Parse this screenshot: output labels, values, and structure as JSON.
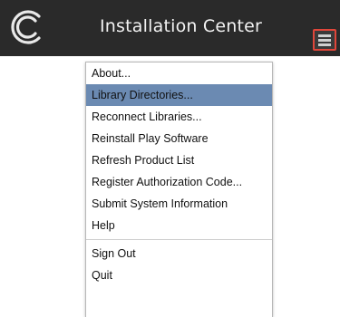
{
  "window": {
    "title": "Installation Center"
  },
  "icons": {
    "logo": "app-logo-icon",
    "menu": "hamburger-menu-icon"
  },
  "colors": {
    "titlebar": "#2a2a2a",
    "selected": "#6b8ab2",
    "menu_button_border": "#e0463a"
  },
  "menu": {
    "group1": [
      {
        "label": "About..."
      },
      {
        "label": "Library Directories...",
        "selected": true
      },
      {
        "label": "Reconnect Libraries..."
      },
      {
        "label": "Reinstall Play Software"
      },
      {
        "label": "Refresh Product List"
      },
      {
        "label": "Register Authorization Code..."
      },
      {
        "label": "Submit System Information"
      },
      {
        "label": "Help"
      }
    ],
    "group2": [
      {
        "label": "Sign Out"
      },
      {
        "label": "Quit"
      }
    ]
  }
}
